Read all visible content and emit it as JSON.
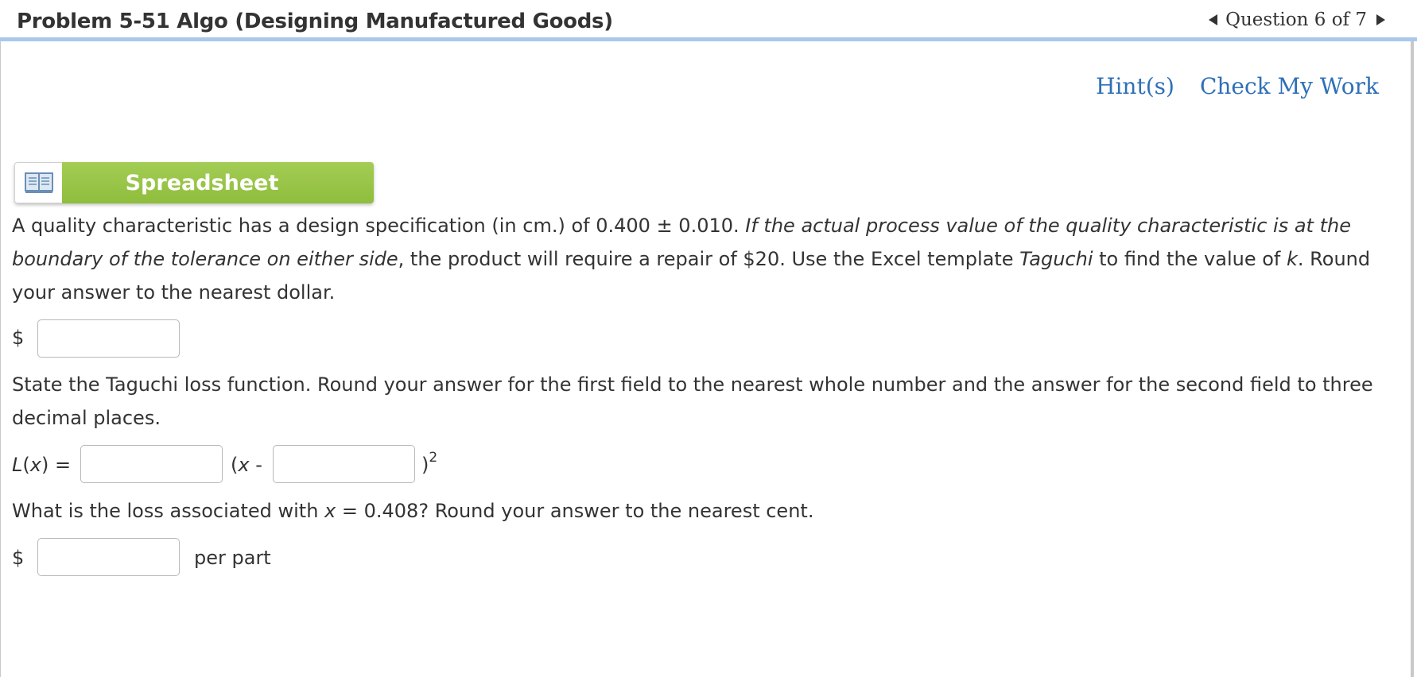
{
  "header": {
    "title": "Problem 5-51 Algo (Designing Manufactured Goods)",
    "question_nav": "Question 6 of 7"
  },
  "links": {
    "hints": "Hint(s)",
    "check_work": "Check My Work"
  },
  "spreadsheet": {
    "label": "Spreadsheet",
    "icon": "book-icon"
  },
  "question": {
    "p1_a": "A quality characteristic has a design specification (in cm.) of 0.400 ± 0.010. ",
    "p1_b": "If the actual process value of the quality characteristic is at the boundary of the tolerance on either side",
    "p1_c": ", the product will require a repair of $20. Use the Excel template ",
    "p1_d": "Taguchi",
    "p1_e": " to find the value of ",
    "p1_f": "k",
    "p1_g": ". Round your answer to the nearest dollar.",
    "dollar1": "$",
    "p2": "State the Taguchi loss function. Round your answer for the first field to the nearest whole number and the answer for the second field to three decimal places.",
    "lx_label_a": "L",
    "lx_label_b": "(",
    "lx_label_c": "x",
    "lx_label_d": ")  =",
    "paren_open_a": "(",
    "paren_open_b": "x",
    "paren_open_c": " -",
    "paren_close": ")",
    "exponent": "2",
    "p3_a": "What is the loss associated with ",
    "p3_b": "x",
    "p3_c": " = 0.408? Round your answer to the nearest cent.",
    "dollar2": "$",
    "per_part": "per part"
  }
}
